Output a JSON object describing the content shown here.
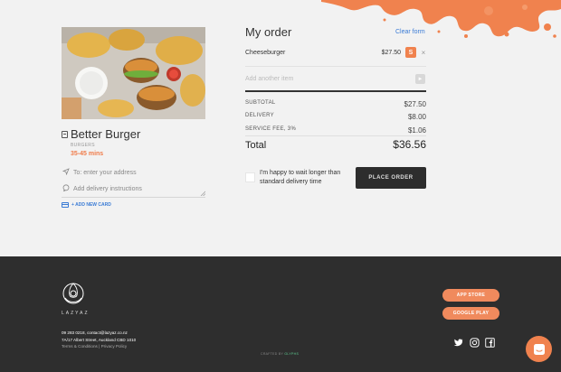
{
  "restaurant": {
    "name": "Better Burger",
    "category": "BURGERS",
    "eta": "35-45 mins"
  },
  "form": {
    "address_placeholder": "To: enter your  address",
    "instructions_placeholder": "Add delivery instructions",
    "add_card_label": "+ ADD NEW CARD"
  },
  "order": {
    "title": "My order",
    "clear_label": "Clear form",
    "items": [
      {
        "name": "Cheeseburger",
        "price": "$27.50",
        "size": "S"
      }
    ],
    "add_item_placeholder": "Add another item",
    "subtotal_label": "SUBTOTAL",
    "subtotal_value": "$27.50",
    "delivery_label": "DELIVERY",
    "delivery_value": "$8.00",
    "fee_label": "SERVICE FEE, 3%",
    "fee_value": "$1.06",
    "total_label": "Total",
    "total_value": "$36.56",
    "wait_text": "I'm happy to wait longer than standard delivery time",
    "place_order_label": "PLACE ORDER"
  },
  "footer": {
    "logo_text": "LAZYAZ",
    "phone_email": "09 283 0218, contact@lazyaz.co.nz",
    "address": "7A/17 Albert Street, Auckland CBD 1010",
    "terms": "Terms & Conditions",
    "privacy": "Privacy Policy",
    "link_sep": "|",
    "crafted_by": "CRAFTED BY",
    "crafted_brand": "GLYPHS",
    "app_store": "APP STORE",
    "google_play": "GOOGLE PLAY",
    "social": [
      "twitter-icon",
      "instagram-icon",
      "facebook-icon"
    ]
  },
  "colors": {
    "accent": "#f0824e",
    "link": "#3a7bd5",
    "footer_bg": "#2e2e2e",
    "button_dark": "#2d2d2d"
  }
}
